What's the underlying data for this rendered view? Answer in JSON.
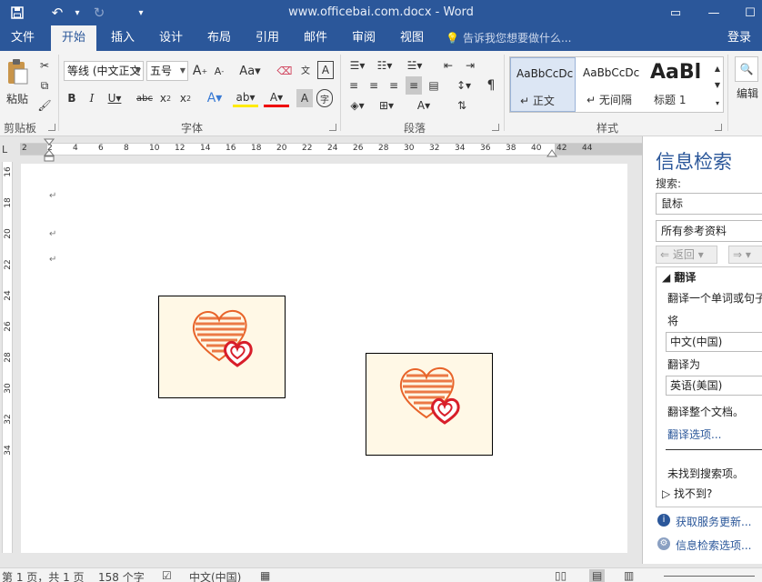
{
  "titlebar": {
    "title": "www.officebai.com.docx - Word",
    "save_icon": "save-icon",
    "undo_icon": "undo-icon",
    "redo_icon": "redo-icon",
    "qa_icon": "customize-quick-access-icon"
  },
  "tabs": {
    "items": [
      "文件",
      "开始",
      "插入",
      "设计",
      "布局",
      "引用",
      "邮件",
      "审阅",
      "视图"
    ],
    "active": "开始",
    "tellme": "告诉我您想要做什么...",
    "login": "登录"
  },
  "ribbon": {
    "clipboard": {
      "paste_label": "粘贴",
      "group": "剪贴板"
    },
    "font": {
      "family": "等线 (中文正文",
      "size": "五号",
      "group": "字体"
    },
    "paragraph": {
      "group": "段落"
    },
    "styles": {
      "group": "样式",
      "items": [
        {
          "sample": "AaBbCcDc",
          "name": "正文"
        },
        {
          "sample": "AaBbCcDc",
          "name": "无间隔"
        },
        {
          "sample": "AaBl",
          "name": "标题 1"
        }
      ]
    },
    "editing": {
      "label": "编辑"
    }
  },
  "ruler": {
    "h_ticks": [
      "2",
      "2",
      "4",
      "6",
      "8",
      "10",
      "12",
      "14",
      "16",
      "18",
      "20",
      "22",
      "24",
      "26",
      "28",
      "30",
      "32",
      "34",
      "36",
      "38",
      "40",
      "42",
      "44"
    ],
    "v_ticks": [
      "16",
      "18",
      "20",
      "22",
      "24",
      "26",
      "28",
      "30",
      "32",
      "34"
    ],
    "corner": "L"
  },
  "document": {
    "pictures": [
      "hearts-image-1",
      "hearts-image-2"
    ],
    "colors": {
      "picture_bg": "#fff8e6",
      "heart_orange": "#e8642a",
      "heart_red": "#d81e2a"
    }
  },
  "panel": {
    "title": "信息检索",
    "search_label": "搜索:",
    "search_value": "鼠标",
    "source_value": "所有参考资料",
    "back_label": "返回",
    "section": "翻译",
    "section_desc": "翻译一个单词或句子",
    "from_label": "将",
    "from_value": "中文(中国)",
    "to_label": "翻译为",
    "to_value": "英语(美国)",
    "translate_doc": "翻译整个文档。",
    "options_link": "翻译选项...",
    "no_result": "未找到搜索项。",
    "not_found": "找不到?",
    "get_updates": "获取服务更新...",
    "research_options": "信息检索选项..."
  },
  "status": {
    "page": "第 1 页，共 1 页",
    "words": "158 个字",
    "language": "中文(中国)"
  }
}
